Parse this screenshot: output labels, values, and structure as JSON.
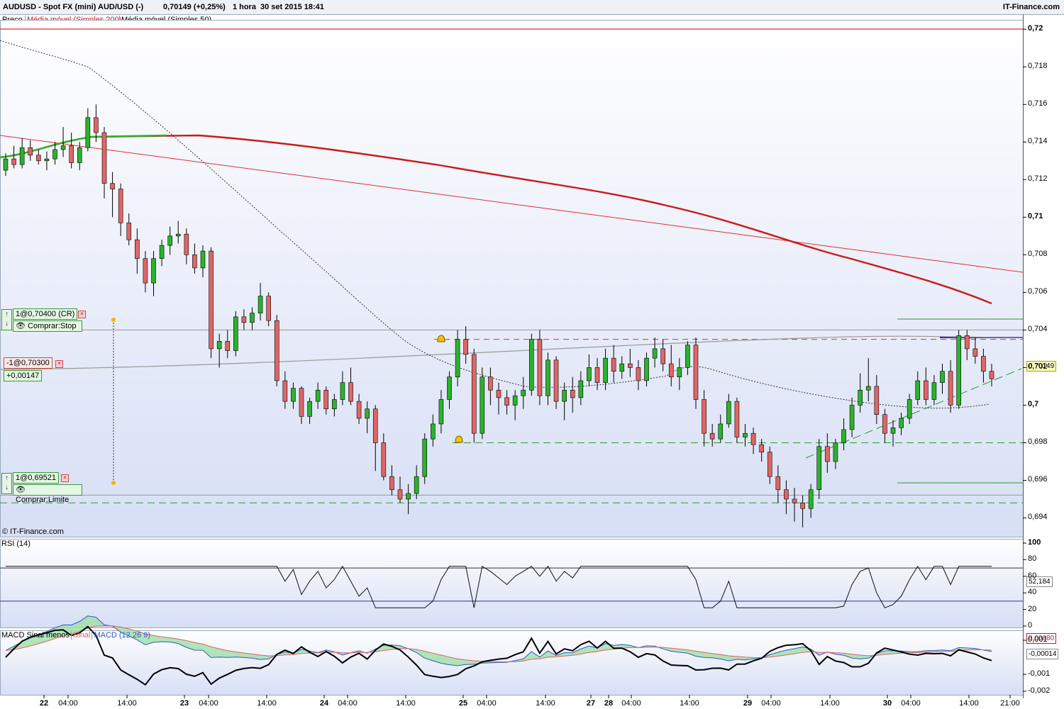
{
  "header": {
    "instrument": "AUDUSD - Spot FX (mini) AUD/USD (-)",
    "price_change": "0,70149 (+0,25%)",
    "period": "1 hora",
    "datetime": "30 set 2015 18:41",
    "brand": "IT-Finance.com"
  },
  "legend": {
    "price": "Preço",
    "ma200": "Média móvel (Simples 200)",
    "ma50": "Média móvel (Simples 50)"
  },
  "watermark": "© IT-Finance.com",
  "orders": {
    "stop_label": "1@0,70400 (CR)",
    "stop_type": "Comprar:Stop",
    "position_label": "-1@0,70300",
    "position_pnl": "+0,00147",
    "limit_label": "1@0,69521",
    "limit_type": "Comprar:Limite",
    "close_glyph": "×",
    "side_glyph_up": "↑",
    "side_glyph_down": "↓"
  },
  "price_axis": {
    "labels": [
      "0,72",
      "0,718",
      "0,716",
      "0,714",
      "0,712",
      "0,71",
      "0,708",
      "0,706",
      "0,704",
      "0,702",
      "0,7",
      "0,698",
      "0,696",
      "0,694"
    ],
    "current": "0,70149"
  },
  "rsi": {
    "title": "RSI (14)",
    "labels": [
      "100",
      "80",
      "60",
      "40",
      "20",
      "0"
    ],
    "current": "52,184"
  },
  "macd": {
    "title": "MACD Sinal menos",
    "signal_name": "Sinal",
    "macd_name": "MACD (12 26 9)",
    "labels": [
      "0,001",
      "-0,001",
      "-0,002"
    ],
    "current_top": "0,00080",
    "current_bottom": "-0,00014"
  },
  "time_axis": [
    "22",
    "04:00",
    "14:00",
    "23",
    "04:00",
    "14:00",
    "24",
    "04:00",
    "14:00",
    "25",
    "04:00",
    "14:00",
    "27",
    "28",
    "04:00",
    "14:00",
    "29",
    "04:00",
    "14:00",
    "30",
    "04:00",
    "14:00",
    "21:00"
  ],
  "colors": {
    "bull": "#2bb32b",
    "bear": "#e06666",
    "ma200": "#cc1a1a",
    "ma50": "#333333",
    "trend_red": "#e03030",
    "support_green": "#2a9a2a",
    "rsi_line": "#111111",
    "macd_line": "#3355cc",
    "signal_line": "#e06060",
    "histogram": "#000000"
  },
  "chart_data": {
    "type": "candlestick",
    "series": [
      {
        "name": "AUDUSD",
        "ohlc": [
          [
            0.7125,
            0.7134,
            0.7122,
            0.7131
          ],
          [
            0.7131,
            0.7138,
            0.7126,
            0.7128
          ],
          [
            0.7128,
            0.7142,
            0.7126,
            0.7137
          ],
          [
            0.7137,
            0.7141,
            0.713,
            0.7133
          ],
          [
            0.7133,
            0.7136,
            0.7128,
            0.713
          ],
          [
            0.713,
            0.7135,
            0.7125,
            0.7131
          ],
          [
            0.7131,
            0.714,
            0.7128,
            0.7136
          ],
          [
            0.7136,
            0.7148,
            0.7132,
            0.7138
          ],
          [
            0.7138,
            0.7145,
            0.7126,
            0.7129
          ],
          [
            0.7129,
            0.714,
            0.7125,
            0.7137
          ],
          [
            0.7137,
            0.7158,
            0.7135,
            0.7153
          ],
          [
            0.7153,
            0.716,
            0.714,
            0.7145
          ],
          [
            0.7145,
            0.7148,
            0.711,
            0.7118
          ],
          [
            0.7118,
            0.7124,
            0.71,
            0.7115
          ],
          [
            0.7115,
            0.7118,
            0.709,
            0.7097
          ],
          [
            0.7097,
            0.7102,
            0.7085,
            0.7088
          ],
          [
            0.7088,
            0.7094,
            0.707,
            0.7078
          ],
          [
            0.7078,
            0.7082,
            0.706,
            0.7065
          ],
          [
            0.7065,
            0.7082,
            0.7058,
            0.7078
          ],
          [
            0.7078,
            0.7088,
            0.7074,
            0.7085
          ],
          [
            0.7085,
            0.7095,
            0.708,
            0.709
          ],
          [
            0.709,
            0.7098,
            0.7086,
            0.7091
          ],
          [
            0.7091,
            0.7094,
            0.7075,
            0.708
          ],
          [
            0.708,
            0.7086,
            0.707,
            0.7073
          ],
          [
            0.7073,
            0.7085,
            0.7068,
            0.7082
          ],
          [
            0.7082,
            0.7084,
            0.7025,
            0.703
          ],
          [
            0.703,
            0.7038,
            0.702,
            0.7034
          ],
          [
            0.7034,
            0.704,
            0.7025,
            0.7029
          ],
          [
            0.7029,
            0.705,
            0.7026,
            0.7047
          ],
          [
            0.7047,
            0.7051,
            0.704,
            0.7044
          ],
          [
            0.7044,
            0.7052,
            0.704,
            0.7049
          ],
          [
            0.7049,
            0.7065,
            0.7045,
            0.7058
          ],
          [
            0.7058,
            0.706,
            0.7042,
            0.7045
          ],
          [
            0.7045,
            0.7048,
            0.701,
            0.7013
          ],
          [
            0.7013,
            0.7018,
            0.6998,
            0.7002
          ],
          [
            0.7002,
            0.7012,
            0.6998,
            0.7009
          ],
          [
            0.7009,
            0.701,
            0.699,
            0.6994
          ],
          [
            0.6994,
            0.7004,
            0.699,
            0.7002
          ],
          [
            0.7002,
            0.7012,
            0.6998,
            0.7008
          ],
          [
            0.7008,
            0.701,
            0.6995,
            0.6998
          ],
          [
            0.6998,
            0.7006,
            0.6994,
            0.7003
          ],
          [
            0.7003,
            0.7018,
            0.7,
            0.7012
          ],
          [
            0.7012,
            0.702,
            0.7,
            0.7002
          ],
          [
            0.7002,
            0.7006,
            0.699,
            0.6993
          ],
          [
            0.6993,
            0.7002,
            0.6985,
            0.6998
          ],
          [
            0.6998,
            0.7,
            0.6965,
            0.698
          ],
          [
            0.698,
            0.6985,
            0.696,
            0.6962
          ],
          [
            0.6962,
            0.6968,
            0.6952,
            0.6955
          ],
          [
            0.6955,
            0.6962,
            0.6948,
            0.695
          ],
          [
            0.695,
            0.6958,
            0.6942,
            0.6953
          ],
          [
            0.6953,
            0.6968,
            0.695,
            0.6962
          ],
          [
            0.6962,
            0.6985,
            0.6958,
            0.6982
          ],
          [
            0.6982,
            0.6995,
            0.6978,
            0.699
          ],
          [
            0.699,
            0.7008,
            0.6985,
            0.7003
          ],
          [
            0.7003,
            0.7018,
            0.6998,
            0.7015
          ],
          [
            0.7015,
            0.704,
            0.701,
            0.7035
          ],
          [
            0.7035,
            0.7042,
            0.7022,
            0.7027
          ],
          [
            0.7027,
            0.703,
            0.698,
            0.6985
          ],
          [
            0.6985,
            0.702,
            0.6982,
            0.7015
          ],
          [
            0.7015,
            0.702,
            0.7,
            0.7008
          ],
          [
            0.7008,
            0.7012,
            0.6995,
            0.7004
          ],
          [
            0.7004,
            0.7008,
            0.6995,
            0.7
          ],
          [
            0.7,
            0.7008,
            0.6992,
            0.7005
          ],
          [
            0.7005,
            0.7015,
            0.6998,
            0.7008
          ],
          [
            0.7008,
            0.7038,
            0.7005,
            0.7035
          ],
          [
            0.7035,
            0.704,
            0.7,
            0.7005
          ],
          [
            0.7005,
            0.7028,
            0.7,
            0.7024
          ],
          [
            0.7024,
            0.7026,
            0.6998,
            0.7002
          ],
          [
            0.7002,
            0.7012,
            0.6992,
            0.7008
          ],
          [
            0.7008,
            0.7015,
            0.6996,
            0.7004
          ],
          [
            0.7004,
            0.7018,
            0.7,
            0.7013
          ],
          [
            0.7013,
            0.7027,
            0.701,
            0.702
          ],
          [
            0.702,
            0.7025,
            0.7008,
            0.7012
          ],
          [
            0.7012,
            0.703,
            0.7008,
            0.7025
          ],
          [
            0.7025,
            0.7032,
            0.7012,
            0.7018
          ],
          [
            0.7018,
            0.7026,
            0.7014,
            0.7022
          ],
          [
            0.7022,
            0.703,
            0.7015,
            0.702
          ],
          [
            0.702,
            0.7024,
            0.7008,
            0.7013
          ],
          [
            0.7013,
            0.7028,
            0.701,
            0.7025
          ],
          [
            0.7025,
            0.7036,
            0.702,
            0.703
          ],
          [
            0.703,
            0.7035,
            0.7018,
            0.7022
          ],
          [
            0.7022,
            0.7032,
            0.701,
            0.7015
          ],
          [
            0.7015,
            0.7025,
            0.7008,
            0.702
          ],
          [
            0.702,
            0.7034,
            0.7016,
            0.7032
          ],
          [
            0.7032,
            0.7036,
            0.6998,
            0.7003
          ],
          [
            0.7003,
            0.7008,
            0.6978,
            0.6985
          ],
          [
            0.6985,
            0.699,
            0.6978,
            0.6982
          ],
          [
            0.6982,
            0.6995,
            0.698,
            0.699
          ],
          [
            0.699,
            0.7006,
            0.6988,
            0.7002
          ],
          [
            0.7002,
            0.7004,
            0.698,
            0.6983
          ],
          [
            0.6983,
            0.699,
            0.6978,
            0.6985
          ],
          [
            0.6985,
            0.6988,
            0.6974,
            0.6979
          ],
          [
            0.6979,
            0.6982,
            0.697,
            0.6975
          ],
          [
            0.6975,
            0.6978,
            0.6958,
            0.6962
          ],
          [
            0.6962,
            0.6968,
            0.6948,
            0.6955
          ],
          [
            0.6955,
            0.696,
            0.6942,
            0.695
          ],
          [
            0.695,
            0.6956,
            0.6938,
            0.6948
          ],
          [
            0.6948,
            0.6952,
            0.6935,
            0.6945
          ],
          [
            0.6945,
            0.6958,
            0.694,
            0.6955
          ],
          [
            0.6955,
            0.6982,
            0.695,
            0.6978
          ],
          [
            0.6978,
            0.6985,
            0.6964,
            0.697
          ],
          [
            0.697,
            0.6982,
            0.6966,
            0.698
          ],
          [
            0.698,
            0.6993,
            0.6976,
            0.6987
          ],
          [
            0.6987,
            0.7004,
            0.6983,
            0.7
          ],
          [
            0.7,
            0.7017,
            0.6996,
            0.7008
          ],
          [
            0.7008,
            0.7025,
            0.7002,
            0.701
          ],
          [
            0.701,
            0.7016,
            0.699,
            0.6995
          ],
          [
            0.6995,
            0.6998,
            0.698,
            0.6985
          ],
          [
            0.6985,
            0.6992,
            0.6978,
            0.6988
          ],
          [
            0.6988,
            0.6996,
            0.6984,
            0.6993
          ],
          [
            0.6993,
            0.7006,
            0.699,
            0.7003
          ],
          [
            0.7003,
            0.7018,
            0.7,
            0.7013
          ],
          [
            0.7013,
            0.702,
            0.7,
            0.7003
          ],
          [
            0.7003,
            0.7016,
            0.7,
            0.7012
          ],
          [
            0.7012,
            0.7022,
            0.7006,
            0.7018
          ],
          [
            0.7018,
            0.7024,
            0.6996,
            0.7
          ],
          [
            0.7,
            0.704,
            0.6998,
            0.7037
          ],
          [
            0.7037,
            0.704,
            0.7024,
            0.703
          ],
          [
            0.703,
            0.7036,
            0.7022,
            0.7026
          ],
          [
            0.7026,
            0.703,
            0.7012,
            0.7018
          ],
          [
            0.7018,
            0.7022,
            0.701,
            0.7014
          ]
        ]
      }
    ],
    "ylim": [
      0.693,
      0.7205
    ],
    "horizontal_levels": [
      0.704,
      0.7035,
      0.698,
      0.69521,
      0.6948
    ]
  }
}
